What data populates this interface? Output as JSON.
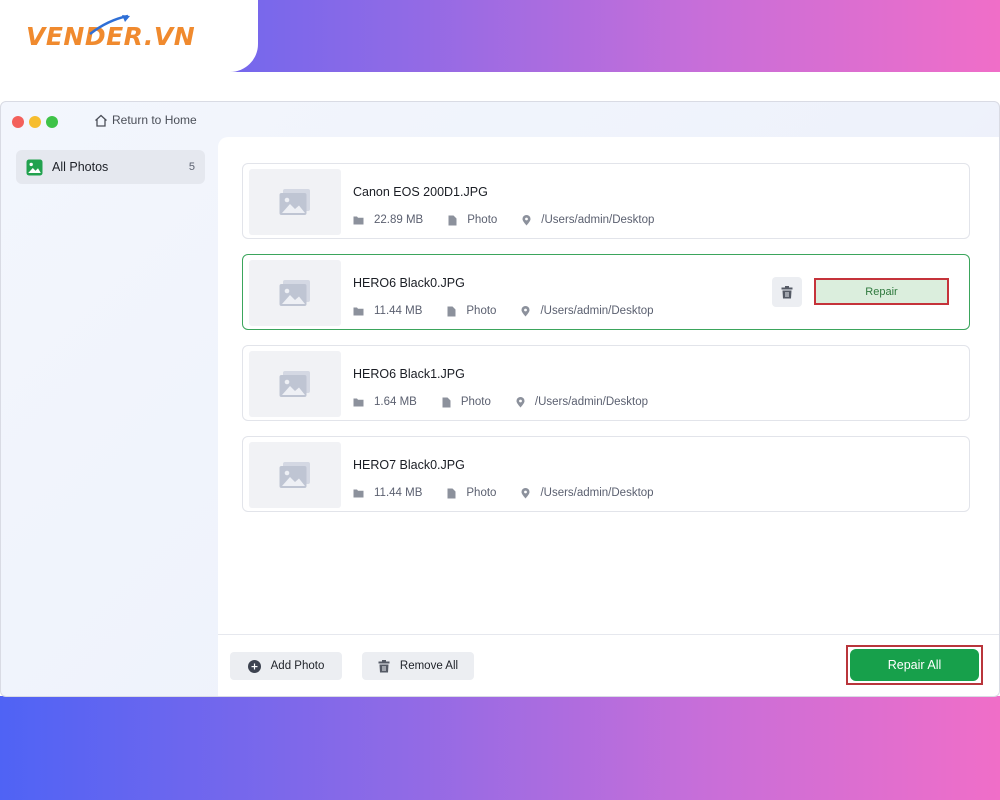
{
  "brand": {
    "logo_text": "VENDER.VN"
  },
  "window": {
    "return_label": "Return to Home"
  },
  "sidebar": {
    "items": [
      {
        "label": "All Photos",
        "count": "5",
        "icon": "photo-icon"
      }
    ]
  },
  "files": [
    {
      "name": "Canon EOS 200D1.JPG",
      "size": "22.89 MB",
      "type": "Photo",
      "path": "/Users/admin/Desktop"
    },
    {
      "name": "HERO6 Black0.JPG",
      "size": "11.44 MB",
      "type": "Photo",
      "path": "/Users/admin/Desktop",
      "selected": true
    },
    {
      "name": "HERO6 Black1.JPG",
      "size": "1.64 MB",
      "type": "Photo",
      "path": "/Users/admin/Desktop"
    },
    {
      "name": "HERO7 Black0.JPG",
      "size": "11.44 MB",
      "type": "Photo",
      "path": "/Users/admin/Desktop"
    }
  ],
  "row_actions": {
    "repair_label": "Repair",
    "delete_icon": "trash-icon"
  },
  "footer": {
    "add_label": "Add Photo",
    "remove_label": "Remove All",
    "repair_all_label": "Repair All"
  },
  "colors": {
    "accent_green": "#17a04b",
    "highlight_red": "#c5333a",
    "logo_orange": "#f08a2e"
  }
}
